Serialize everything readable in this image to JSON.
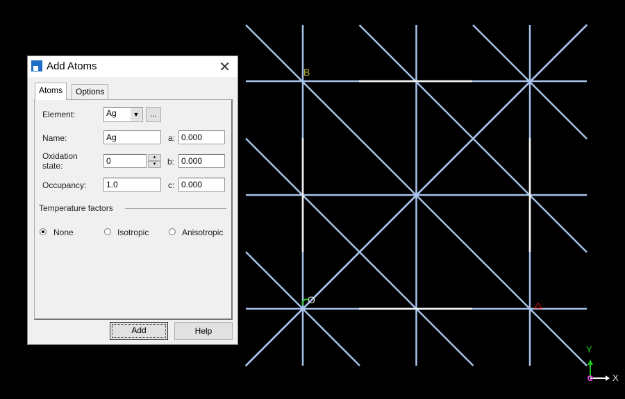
{
  "viewer": {
    "labels": {
      "origin": "O",
      "b_axis": "B"
    },
    "axes": {
      "x": "X",
      "y": "Y"
    },
    "colors": {
      "bond": "#a9c4ec",
      "cell": "#f4f4f4",
      "x": "#ffffff",
      "y": "#1ec81e",
      "a": "#e01010",
      "b": "#b8b832"
    }
  },
  "dialog": {
    "title": "Add Atoms",
    "close_icon": "close-icon",
    "tabs": [
      {
        "label": "Atoms",
        "active": true
      },
      {
        "label": "Options",
        "active": false
      }
    ],
    "element_label": "Element:",
    "element_value": "Ag",
    "browse_label": "...",
    "name_label": "Name:",
    "name_value": "Ag",
    "oxidation_label_1": "Oxidation",
    "oxidation_label_2": "state:",
    "oxidation_value": "0",
    "occupancy_label": "Occupancy:",
    "occupancy_value": "1.0",
    "a_label": "a:",
    "a_value": "0.000",
    "b_label": "b:",
    "b_value": "0.000",
    "c_label": "c:",
    "c_value": "0.000",
    "temp_heading": "Temperature factors",
    "temp_options": [
      {
        "label": "None",
        "selected": true
      },
      {
        "label": "Isotropic",
        "selected": false
      },
      {
        "label": "Anisotropic",
        "selected": false
      }
    ],
    "add_label": "Add",
    "help_label": "Help"
  }
}
